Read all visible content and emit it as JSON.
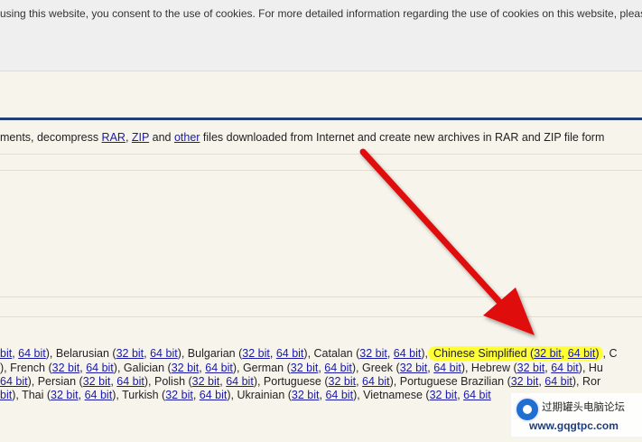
{
  "cookie_notice": "using this website, you consent to the use of cookies. For more detailed information regarding the use of cookies on this website, please",
  "description": {
    "before": "ments, decompress ",
    "rar": "RAR",
    "sep1": ", ",
    "zip": "ZIP",
    "and": " and ",
    "other": "other",
    "after": " files downloaded from Internet and create new archives in RAR and ZIP file form"
  },
  "languages": {
    "line1": [
      {
        "link": "bit"
      },
      {
        "t": ", "
      },
      {
        "link": "64 bit"
      },
      {
        "t": "), Belarusian ("
      },
      {
        "link": "32 bit"
      },
      {
        "t": ", "
      },
      {
        "link": "64 bit"
      },
      {
        "t": "), Bulgarian ("
      },
      {
        "link": "32 bit"
      },
      {
        "t": ", "
      },
      {
        "link": "64 bit"
      },
      {
        "t": "), Catalan ("
      },
      {
        "link": "32 bit"
      },
      {
        "t": ", "
      },
      {
        "link": "64 bit"
      },
      {
        "t": "),"
      },
      {
        "hl": [
          {
            "t": "Chinese Simplified ("
          },
          {
            "link": "32 bit"
          },
          {
            "t": ", "
          },
          {
            "link": "64 bit"
          },
          {
            "t": ")"
          }
        ]
      },
      {
        "t": ", C"
      }
    ],
    "line2": [
      {
        "t": "), French ("
      },
      {
        "link": "32 bit"
      },
      {
        "t": ", "
      },
      {
        "link": "64 bit"
      },
      {
        "t": "), Galician ("
      },
      {
        "link": "32 bit"
      },
      {
        "t": ", "
      },
      {
        "link": "64 bit"
      },
      {
        "t": "), German ("
      },
      {
        "link": "32 bit"
      },
      {
        "t": ", "
      },
      {
        "link": "64 bit"
      },
      {
        "t": "), Greek ("
      },
      {
        "link": "32 bit"
      },
      {
        "t": ", "
      },
      {
        "link": "64 bit"
      },
      {
        "t": "), Hebrew ("
      },
      {
        "link": "32 bit"
      },
      {
        "t": ", "
      },
      {
        "link": "64 bit"
      },
      {
        "t": "), Hu"
      }
    ],
    "line3": [
      {
        "link": "64 bit"
      },
      {
        "t": "), Persian ("
      },
      {
        "link": "32 bit"
      },
      {
        "t": ", "
      },
      {
        "link": "64 bit"
      },
      {
        "t": "), Polish ("
      },
      {
        "link": "32 bit"
      },
      {
        "t": ", "
      },
      {
        "link": "64 bit"
      },
      {
        "t": "), Portuguese ("
      },
      {
        "link": "32 bit"
      },
      {
        "t": ", "
      },
      {
        "link": "64 bit"
      },
      {
        "t": "), Portuguese Brazilian ("
      },
      {
        "link": "32 bit"
      },
      {
        "t": ", "
      },
      {
        "link": "64 bit"
      },
      {
        "t": "), Ror"
      }
    ],
    "line4": [
      {
        "link": "bit"
      },
      {
        "t": "), Thai ("
      },
      {
        "link": "32 bit"
      },
      {
        "t": ", "
      },
      {
        "link": "64 bit"
      },
      {
        "t": "), Turkish ("
      },
      {
        "link": "32 bit"
      },
      {
        "t": ", "
      },
      {
        "link": "64 bit"
      },
      {
        "t": "), Ukrainian ("
      },
      {
        "link": "32 bit"
      },
      {
        "t": ", "
      },
      {
        "link": "64 bit"
      },
      {
        "t": "), Vietnamese ("
      },
      {
        "link": "32 bit"
      },
      {
        "t": ", "
      },
      {
        "link": "64 bit"
      }
    ]
  },
  "watermark": {
    "name": "过期罐头电脑论坛",
    "url": "www.gqgtpc.com"
  },
  "colors": {
    "link": "#1a1aa6",
    "highlight": "#ffff33",
    "arrow": "#e01010",
    "rule": "#243e78"
  }
}
